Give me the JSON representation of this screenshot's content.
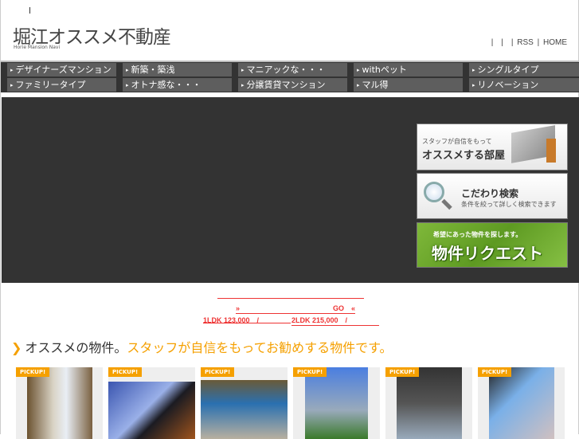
{
  "header": {
    "logo": "堀江オススメ不動産",
    "logo_sub": "Horie Mansion Navi",
    "links_prefix": "|　|　",
    "rss": "| RSS",
    "home": "| HOME"
  },
  "nav": [
    [
      "デザイナーズマンション",
      "ファミリータイプ"
    ],
    [
      "新築・築浅",
      "オトナ感な・・・"
    ],
    [
      "マニアックな・・・",
      "分譲賃貸マンション"
    ],
    [
      "withペット",
      "マル得"
    ],
    [
      "シングルタイプ",
      "リノベーション"
    ]
  ],
  "banners": {
    "b1_small": "スタッフが自信をもって",
    "b1_big": "オススメする部屋",
    "b2_big": "こだわり検索",
    "b2_small": "条件を絞って詳しく検索できます",
    "b3_small": "希望にあった物件を探します。",
    "b3_big": "物件リクエスト"
  },
  "search": {
    "go": "»　　　　　　　　　　　　　GO　«",
    "price1": "1LDK 123,000　/",
    "price2": "2LDK 215,000　/"
  },
  "section": {
    "title": "オススメの物件。",
    "subtitle": "スタッフが自信をもってお勧めする物件です。"
  },
  "cards": [
    {
      "badge": "PICKUP!"
    },
    {
      "badge": "PICKUP!"
    },
    {
      "badge": "PICKUP!"
    },
    {
      "badge": "PICKUP!"
    },
    {
      "badge": "PICKUP!"
    },
    {
      "badge": "PICKUP!"
    }
  ]
}
